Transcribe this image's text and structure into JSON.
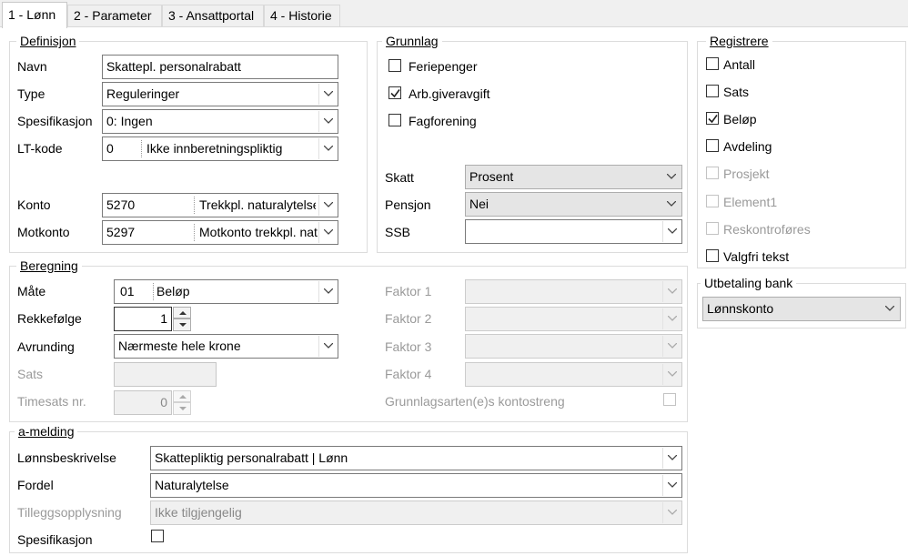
{
  "tabs": [
    "1 - Lønn",
    "2 - Parameter",
    "3 - Ansattportal",
    "4 - Historie"
  ],
  "definisjon": {
    "title": "Definisjon",
    "navn_label": "Navn",
    "navn_value": "Skattepl. personalrabatt",
    "type_label": "Type",
    "type_value": "Reguleringer",
    "spes_label": "Spesifikasjon",
    "spes_value": "0:  Ingen",
    "lt_label": "LT-kode",
    "lt_code": "0",
    "lt_text": "Ikke innberetningspliktig",
    "konto_label": "Konto",
    "konto_code": "5270",
    "konto_text": "Trekkpl. naturalytelse",
    "motkonto_label": "Motkonto",
    "motkonto_code": "5297",
    "motkonto_text": "Motkonto trekkpl. naturalytelse"
  },
  "grunnlag": {
    "title": "Grunnlag",
    "checks": [
      {
        "label": "Feriepenger",
        "checked": false
      },
      {
        "label": "Arb.giveravgift",
        "checked": true
      },
      {
        "label": "Fagforening",
        "checked": false
      }
    ],
    "skatt_label": "Skatt",
    "skatt_value": "Prosent",
    "pensjon_label": "Pensjon",
    "pensjon_value": "Nei",
    "ssb_label": "SSB",
    "ssb_value": ""
  },
  "registrere": {
    "title": "Registrere",
    "items": [
      {
        "label": "Antall",
        "checked": false,
        "enabled": true
      },
      {
        "label": "Sats",
        "checked": false,
        "enabled": true
      },
      {
        "label": "Beløp",
        "checked": true,
        "enabled": true
      },
      {
        "label": "Avdeling",
        "checked": false,
        "enabled": true
      },
      {
        "label": "Prosjekt",
        "checked": false,
        "enabled": false
      },
      {
        "label": "Element1",
        "checked": false,
        "enabled": false
      },
      {
        "label": "Reskontroføres",
        "checked": false,
        "enabled": false
      },
      {
        "label": "Valgfri tekst",
        "checked": false,
        "enabled": true
      }
    ]
  },
  "utbetaling": {
    "title": "Utbetaling bank",
    "value": "Lønnskonto"
  },
  "beregning": {
    "title": "Beregning",
    "mate_label": "Måte",
    "mate_code": "01",
    "mate_text": "Beløp",
    "rekke_label": "Rekkefølge",
    "rekke_value": "1",
    "avrunding_label": "Avrunding",
    "avrunding_value": "Nærmeste hele krone",
    "sats_label": "Sats",
    "sats_value": "",
    "timesats_label": "Timesats nr.",
    "timesats_value": "0",
    "faktor1": "Faktor 1",
    "faktor2": "Faktor 2",
    "faktor3": "Faktor 3",
    "faktor4": "Faktor 4",
    "grunnlags_label": "Grunnlagsarten(e)s kontostreng"
  },
  "amelding": {
    "title": "a-melding",
    "lonn_label": "Lønnsbeskrivelse",
    "lonn_value": "Skattepliktig personalrabatt | Lønn",
    "fordel_label": "Fordel",
    "fordel_value": "Naturalytelse",
    "tillegg_label": "Tilleggsopplysning",
    "tillegg_value": "Ikke tilgjengelig",
    "spes_label": "Spesifikasjon"
  }
}
